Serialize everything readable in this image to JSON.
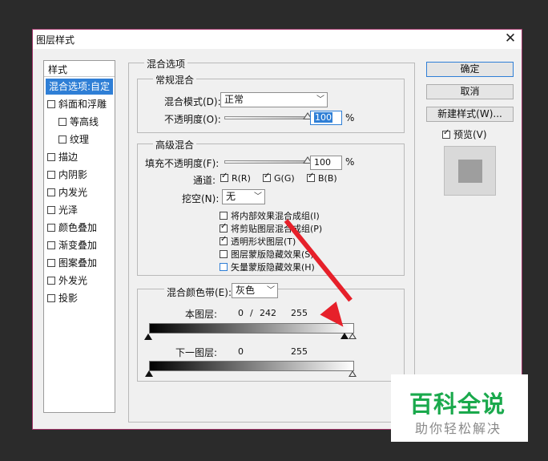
{
  "dialog": {
    "title": "图层样式"
  },
  "style_list": {
    "header": "样式",
    "items": [
      {
        "label": "混合选项:自定",
        "checkbox": false,
        "selected": true
      },
      {
        "label": "斜面和浮雕",
        "checkbox": true,
        "checked": false
      },
      {
        "label": "等高线",
        "checkbox": true,
        "checked": false,
        "indent": true
      },
      {
        "label": "纹理",
        "checkbox": true,
        "checked": false,
        "indent": true
      },
      {
        "label": "描边",
        "checkbox": true,
        "checked": false
      },
      {
        "label": "内阴影",
        "checkbox": true,
        "checked": false
      },
      {
        "label": "内发光",
        "checkbox": true,
        "checked": false
      },
      {
        "label": "光泽",
        "checkbox": true,
        "checked": false
      },
      {
        "label": "颜色叠加",
        "checkbox": true,
        "checked": false
      },
      {
        "label": "渐变叠加",
        "checkbox": true,
        "checked": false
      },
      {
        "label": "图案叠加",
        "checkbox": true,
        "checked": false
      },
      {
        "label": "外发光",
        "checkbox": true,
        "checked": false
      },
      {
        "label": "投影",
        "checkbox": true,
        "checked": false
      }
    ]
  },
  "blending_options": {
    "legend": "混合选项",
    "general": {
      "legend": "常规混合",
      "mode_label": "混合模式(D):",
      "mode_value": "正常",
      "opacity_label": "不透明度(O):",
      "opacity_value": "100",
      "opacity_unit": "%",
      "opacity_level": 1.0
    },
    "advanced": {
      "legend": "高级混合",
      "fill_label": "填充不透明度(F):",
      "fill_value": "100",
      "fill_unit": "%",
      "fill_level": 1.0,
      "channels_label": "通道:",
      "channel_r": "R(R)",
      "channel_g": "G(G)",
      "channel_b": "B(B)",
      "knockout_label": "挖空(N):",
      "knockout_value": "无",
      "options": [
        {
          "label": "将内部效果混合成组(I)",
          "checked": false
        },
        {
          "label": "将剪贴图层混合成组(P)",
          "checked": true
        },
        {
          "label": "透明形状图层(T)",
          "checked": true
        },
        {
          "label": "图层蒙版隐藏效果(S)",
          "checked": false
        },
        {
          "label": "矢量蒙版隐藏效果(H)",
          "checked": false
        }
      ]
    },
    "blend_if": {
      "label": "混合颜色带(E):",
      "value": "灰色",
      "this_layer_label": "本图层:",
      "this_layer_low": "0",
      "this_layer_sep": "/",
      "this_layer_mid": "242",
      "this_layer_high": "255",
      "underlying_label": "下一图层:",
      "underlying_low": "0",
      "underlying_high": "255"
    }
  },
  "buttons": {
    "ok": "确定",
    "cancel": "取消",
    "new_style": "新建样式(W)...",
    "preview_label": "预览(V)"
  },
  "watermark": {
    "title": "百科全说",
    "subtitle": "助你轻松解决"
  },
  "colors": {
    "selection": "#2f7fd6",
    "annotation_arrow": "#e6202a",
    "watermark_green": "#1aa94c"
  }
}
